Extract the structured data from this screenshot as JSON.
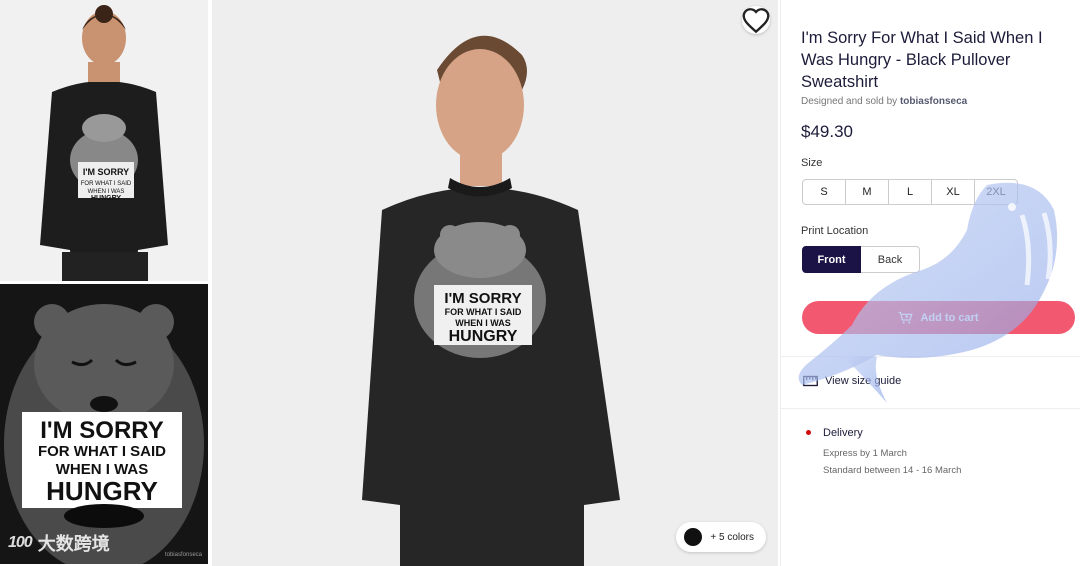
{
  "product": {
    "title": "I'm Sorry For What I Said When I Was Hungry - Black Pullover Sweatshirt",
    "designed_prefix": "Designed and sold by",
    "designer": "tobiasfonseca",
    "price": "$49.30"
  },
  "size": {
    "label": "Size",
    "options": [
      "S",
      "M",
      "L",
      "XL",
      "2XL"
    ]
  },
  "print_location": {
    "label": "Print Location",
    "options": [
      "Front",
      "Back"
    ],
    "selected": "Front"
  },
  "cart": {
    "label": "Add to cart"
  },
  "size_guide": {
    "label": "View size guide"
  },
  "delivery": {
    "title": "Delivery",
    "express": "Express by 1 March",
    "standard": "Standard between 14 - 16 March"
  },
  "colors": {
    "label": "+ 5 colors",
    "current_swatch": "#111111"
  },
  "artwork": {
    "line1": "I'M SORRY",
    "line2": "FOR WHAT I SAID",
    "line3": "WHEN I WAS",
    "line4": "HUNGRY",
    "signature": "tobiasfonseca"
  },
  "watermark": {
    "text": "大数跨境",
    "mark": "100"
  },
  "colors_theme": {
    "accent": "#f2586f",
    "selected": "#1b1245",
    "delivery_dot": "#d10a0a"
  }
}
